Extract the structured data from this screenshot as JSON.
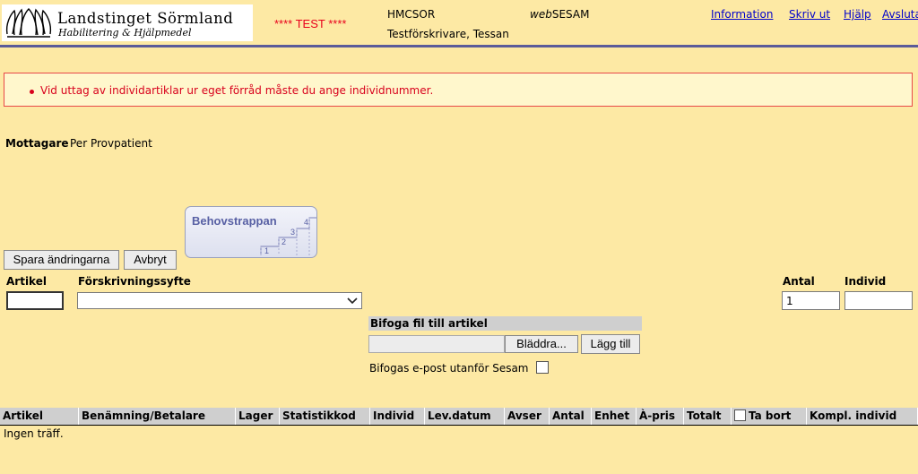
{
  "header": {
    "org_name": "Landstinget Sörmland",
    "org_sub": "Habilitering & Hjälpmedel",
    "test_banner": "**** TEST ****",
    "user_code": "HMCSOR",
    "user_name": "Testförskrivare, Tessan",
    "app_prefix": "web",
    "app_name": "SESAM",
    "links": [
      "Information",
      "Skriv ut",
      "Hjälp",
      "Avsluta"
    ]
  },
  "error": {
    "message": "Vid uttag av individartiklar ur eget förråd måste du ange individnummer."
  },
  "recipient": {
    "label": "Mottagare",
    "value": "Per Provpatient"
  },
  "behovstrappan": {
    "label": "Behovstrappan",
    "steps": [
      "1",
      "2",
      "3",
      "4"
    ]
  },
  "buttons": {
    "save": "Spara ändringarna",
    "cancel": "Avbryt",
    "browse": "Bläddra...",
    "add": "Lägg till"
  },
  "form": {
    "article_label": "Artikel",
    "purpose_label": "Förskrivningssyfte",
    "purpose_value": "",
    "antal_label": "Antal",
    "antal_value": "1",
    "individ_label": "Individ",
    "individ_value": "",
    "attach_header": "Bifoga fil till artikel",
    "email_label": "Bifogas e-post utanför Sesam"
  },
  "table": {
    "columns": [
      "Artikel",
      "Benämning/Betalare",
      "Lager",
      "Statistikkod",
      "Individ",
      "Lev.datum",
      "Avser",
      "Antal",
      "Enhet",
      "À-pris",
      "Totalt",
      "Ta bort",
      "Kompl. individ"
    ],
    "empty_text": "Ingen träff."
  },
  "colors": {
    "background": "#fde9a4",
    "error": "#d8001c",
    "link": "#0000cc",
    "rule": "#5b5b99"
  }
}
